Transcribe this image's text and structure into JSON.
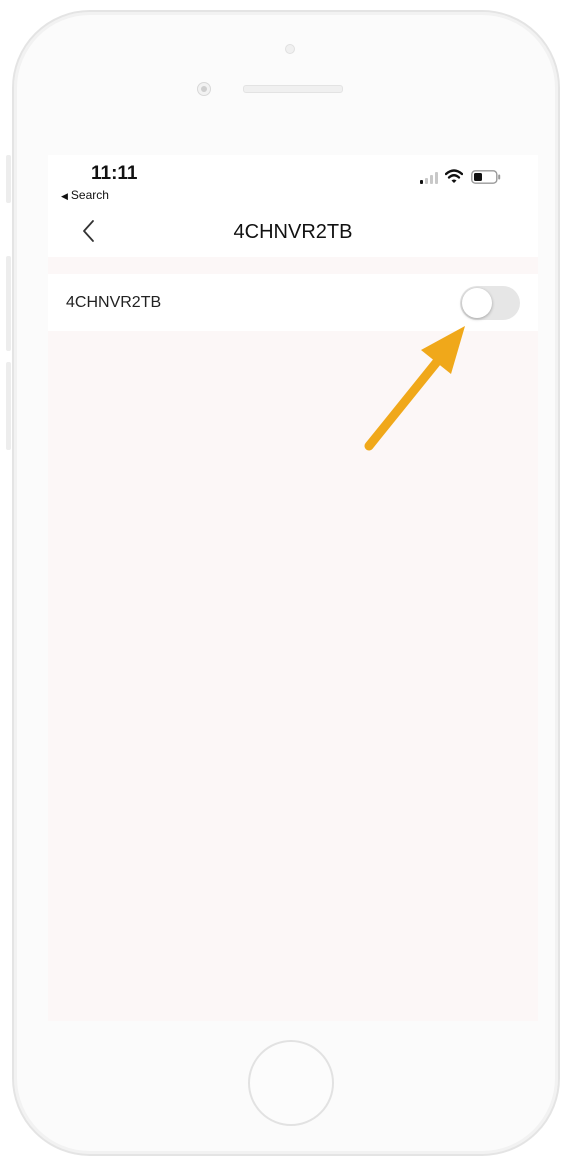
{
  "status_bar": {
    "time": "11:11",
    "back_app_label": "Search",
    "back_app_arrow": "◀",
    "icons": [
      "signal-icon",
      "wifi-icon",
      "battery-icon"
    ]
  },
  "nav": {
    "back_icon": "chevron-left-icon",
    "title": "4CHNVR2TB"
  },
  "list": {
    "items": [
      {
        "label": "4CHNVR2TB",
        "toggle_on": false
      }
    ]
  },
  "annotation": {
    "arrow_color": "#F0A81A",
    "points_to": "toggle"
  },
  "colors": {
    "content_bg": "#FCF7F7",
    "toggle_off": "#E6E6E6"
  }
}
